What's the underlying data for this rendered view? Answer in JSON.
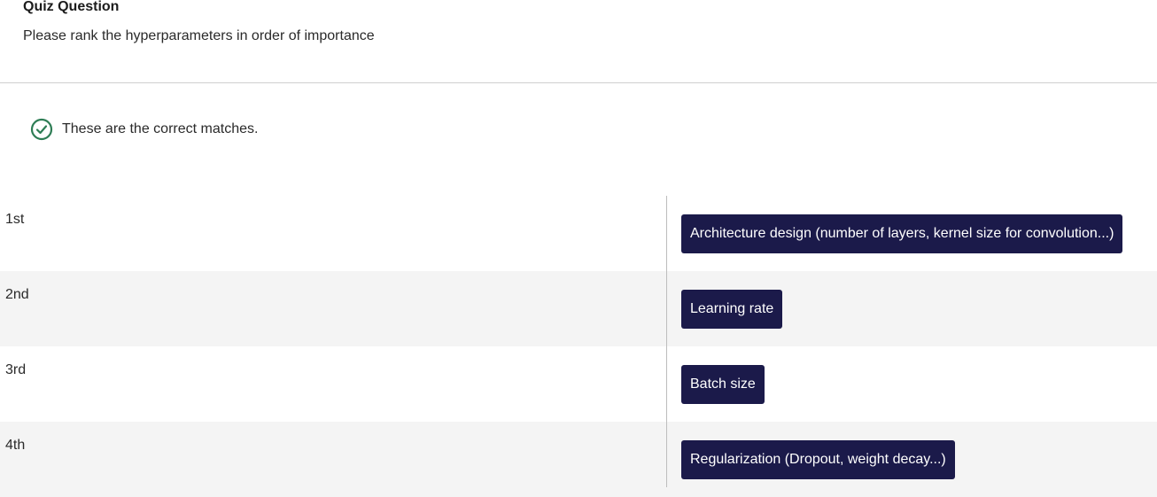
{
  "quiz": {
    "title": "Quiz Question",
    "prompt": "Please rank the hyperparameters in order of importance"
  },
  "feedback": {
    "icon": "check-circle-icon",
    "message": "These are the correct matches.",
    "color": "#2e7d55"
  },
  "ranking": {
    "rows": [
      {
        "rank": "1st",
        "match": "Architecture design (number of layers, kernel size for convolution...)"
      },
      {
        "rank": "2nd",
        "match": "Learning rate"
      },
      {
        "rank": "3rd",
        "match": "Batch size"
      },
      {
        "rank": "4th",
        "match": "Regularization (Dropout, weight decay...)"
      }
    ]
  },
  "colors": {
    "chip_background": "#1b1a4a",
    "row_shade": "#f4f4f4"
  }
}
